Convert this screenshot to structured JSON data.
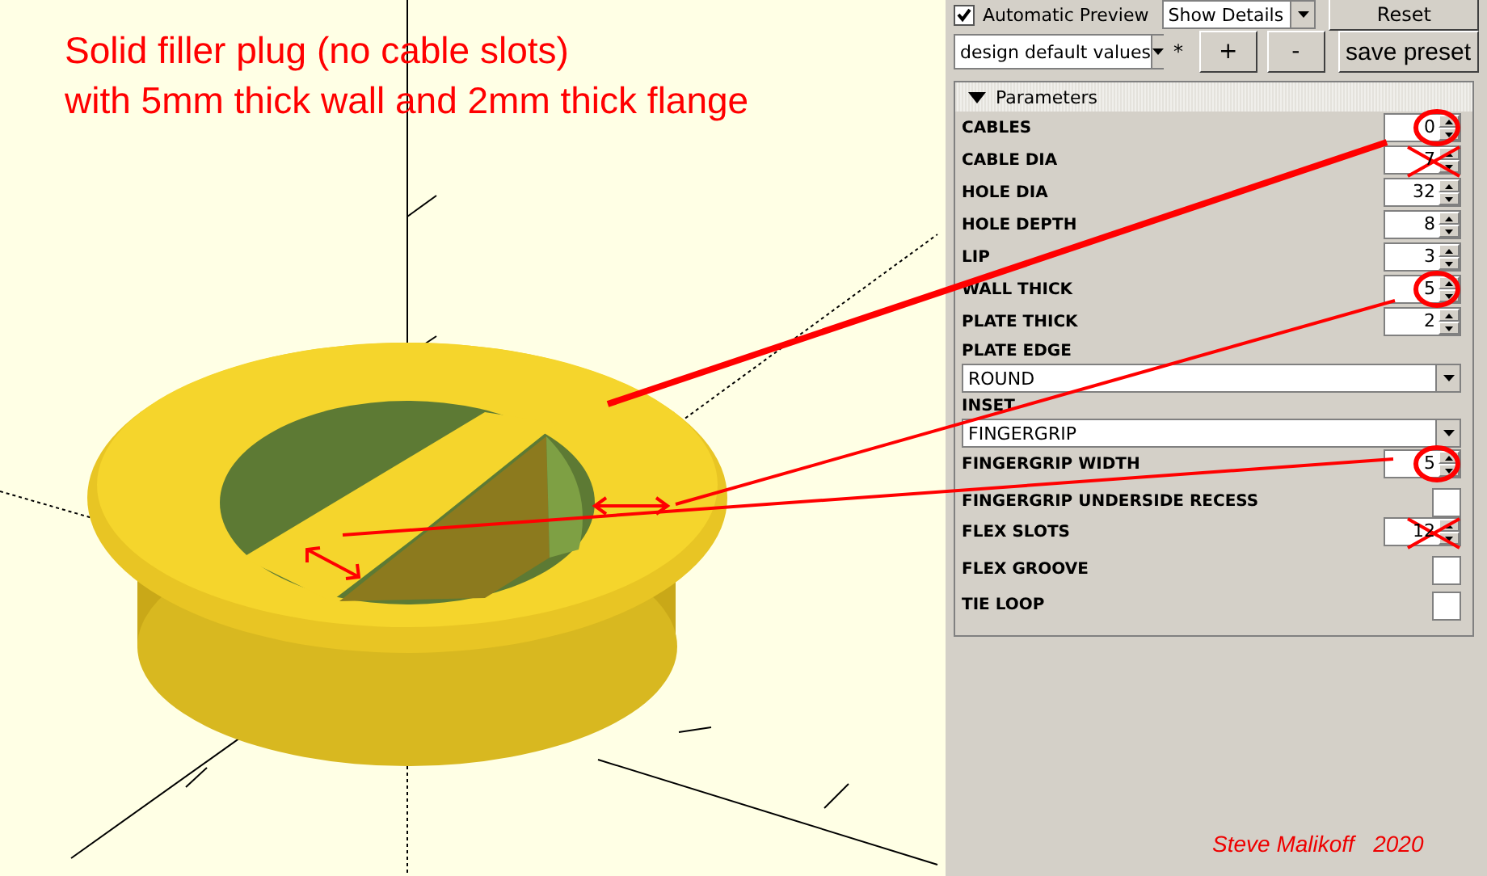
{
  "viewport": {
    "caption_lines": [
      "Solid filler plug (no cable slots)",
      "with 5mm thick wall and 2mm thick flange"
    ],
    "signature": "Steve Malikoff   2020"
  },
  "toolbar": {
    "auto_preview": {
      "label": "Automatic Preview",
      "checked": true
    },
    "details_dropdown": "Show Details",
    "reset_button": "Reset"
  },
  "preset_bar": {
    "preset": "design default values",
    "modified_mark": "*",
    "add_button": "+",
    "remove_button": "-",
    "save_button": "save preset"
  },
  "parameters": {
    "title": "Parameters",
    "expanded": true,
    "items": [
      {
        "kind": "spin",
        "label": "CABLES",
        "value": "0",
        "circled": true,
        "crossed_out": false
      },
      {
        "kind": "spin",
        "label": "CABLE DIA",
        "value": "7",
        "circled": false,
        "crossed_out": true
      },
      {
        "kind": "spin",
        "label": "HOLE DIA",
        "value": "32",
        "circled": false,
        "crossed_out": false
      },
      {
        "kind": "spin",
        "label": "HOLE DEPTH",
        "value": "8",
        "circled": false,
        "crossed_out": false
      },
      {
        "kind": "spin",
        "label": "LIP",
        "value": "3",
        "circled": false,
        "crossed_out": false
      },
      {
        "kind": "spin",
        "label": "WALL THICK",
        "value": "5",
        "circled": true,
        "crossed_out": false
      },
      {
        "kind": "spin",
        "label": "PLATE THICK",
        "value": "2",
        "circled": false,
        "crossed_out": false
      },
      {
        "kind": "dropdown",
        "label": "PLATE EDGE",
        "value": "ROUND"
      },
      {
        "kind": "dropdown",
        "label": "INSET",
        "value": "FINGERGRIP"
      },
      {
        "kind": "spin",
        "label": "FINGERGRIP WIDTH",
        "value": "5",
        "circled": true,
        "crossed_out": false
      },
      {
        "kind": "checkbox",
        "label": "FINGERGRIP UNDERSIDE RECESS",
        "checked": false
      },
      {
        "kind": "spin",
        "label": "FLEX SLOTS",
        "value": "12",
        "circled": false,
        "crossed_out": true
      },
      {
        "kind": "checkbox",
        "label": "FLEX GROOVE",
        "checked": false
      },
      {
        "kind": "checkbox",
        "label": "TIE LOOP",
        "checked": false
      }
    ]
  }
}
